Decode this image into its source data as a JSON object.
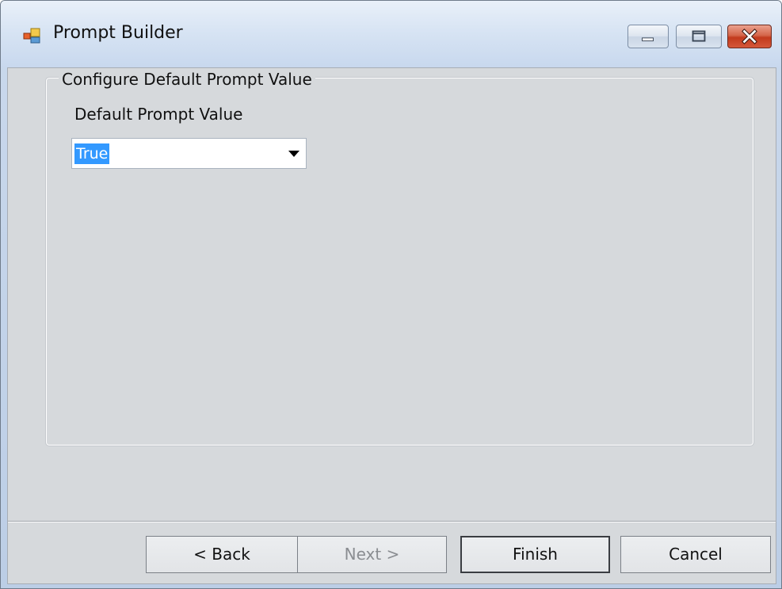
{
  "window": {
    "title": "Prompt Builder",
    "icon": "app-window-icon"
  },
  "caption_buttons": [
    "minimize-icon",
    "maximize-icon",
    "close-icon"
  ],
  "group": {
    "legend": "Configure Default Prompt Value",
    "field_label": "Default Prompt Value",
    "combo_value": "True"
  },
  "buttons": {
    "back": "< Back",
    "next": "Next >",
    "finish": "Finish",
    "cancel": "Cancel"
  },
  "colors": {
    "selection": "#3399ff",
    "client_bg": "#d6d9dc",
    "close_button": "#c23a1d"
  }
}
